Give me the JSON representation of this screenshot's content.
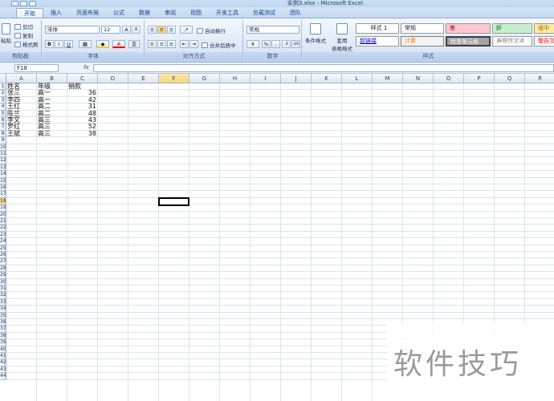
{
  "window": {
    "title": "实例3.xlsx - Microsoft Excel"
  },
  "tabs": [
    "开始",
    "插入",
    "页面布局",
    "公式",
    "数据",
    "审阅",
    "视图",
    "开发工具",
    "负载测试",
    "团队"
  ],
  "ribbon": {
    "clipboard": {
      "paste": "粘贴",
      "cut": "剪切",
      "copy": "复制",
      "format_painter": "格式刷",
      "label": "剪贴板"
    },
    "font": {
      "name": "宋体",
      "size": "12",
      "grow": "A",
      "shrink": "A",
      "bold": "B",
      "italic": "I",
      "underline": "U",
      "font_color": "A",
      "phonetic": "变",
      "label": "字体"
    },
    "alignment": {
      "wrap": "自动换行",
      "merge": "合并后居中",
      "label": "对齐方式"
    },
    "number": {
      "format": "常规",
      "percent": "%",
      "comma": ",",
      "label": "数字"
    },
    "styles": {
      "conditional": "条件格式",
      "table": "套用\n表格格式",
      "label": "样式",
      "cells": [
        {
          "name": "样式 1",
          "bg": "#ffffff"
        },
        {
          "name": "常规",
          "bg": "#ffffff"
        },
        {
          "name": "差",
          "bg": "#ffc7ce"
        },
        {
          "name": "好",
          "bg": "#c6efce"
        },
        {
          "name": "适中",
          "bg": "#ffeb9c"
        },
        {
          "name": "超链接",
          "bg": "#ffffff"
        },
        {
          "name": "计算",
          "bg": "#f2f2f2"
        },
        {
          "name": "检查单元格",
          "bg": "#a5a5a5"
        },
        {
          "name": "解释性文本",
          "bg": "#ffffff"
        },
        {
          "name": "警告文本",
          "bg": "#ffffff"
        }
      ]
    }
  },
  "formula_bar": {
    "name_box": "F18",
    "fx": "fx",
    "value": ""
  },
  "columns": [
    "A",
    "B",
    "C",
    "D",
    "E",
    "F",
    "G",
    "H",
    "I",
    "J",
    "K",
    "L",
    "M",
    "N",
    "O",
    "P",
    "Q",
    "R"
  ],
  "selected_column": "F",
  "selected_row": "18",
  "rows": [
    "1",
    "2",
    "3",
    "4",
    "5",
    "6",
    "7",
    "8",
    "9",
    "10",
    "11",
    "12",
    "13",
    "14",
    "15",
    "16",
    "17",
    "18",
    "19",
    "20",
    "21",
    "22",
    "23",
    "24",
    "25",
    "26",
    "27",
    "28",
    "29",
    "30",
    "31",
    "32",
    "33",
    "34",
    "35",
    "36",
    "37",
    "38",
    "39",
    "40",
    "41",
    "42",
    "43",
    "44"
  ],
  "sheet": {
    "header": [
      "姓名",
      "年级",
      "捐款"
    ],
    "data": [
      [
        "张三",
        "高一",
        "36"
      ],
      [
        "李四",
        "高一",
        "42"
      ],
      [
        "王红",
        "高二",
        "31"
      ],
      [
        "陈兰",
        "高二",
        "48"
      ],
      [
        "李文",
        "高三",
        "43"
      ],
      [
        "罗红",
        "高三",
        "52"
      ],
      [
        "王斌",
        "高三",
        "38"
      ]
    ]
  },
  "watermark": "软件技巧"
}
